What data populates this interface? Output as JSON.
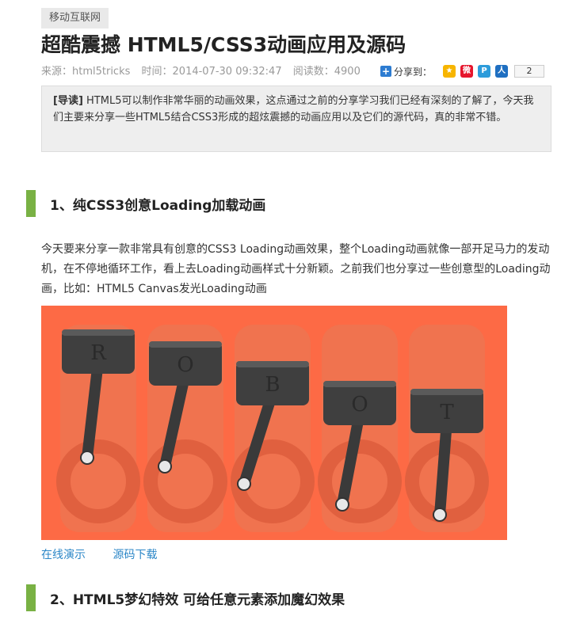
{
  "category": "移动互联网",
  "title": "超酷震撼 HTML5/CSS3动画应用及源码",
  "meta": {
    "source": "来源：html5tricks",
    "time": "时间：2014-07-30 09:32:47",
    "views": "阅读数：4900"
  },
  "share": {
    "label": "分享到：",
    "count": "2",
    "icons": [
      "qzone-icon",
      "weibo-icon",
      "pengyou-icon",
      "renren-icon"
    ],
    "colors": {
      "qzone": "#f7b500",
      "weibo": "#e6162d",
      "pengyou": "#2d9cdb",
      "renren": "#1f6fc1"
    }
  },
  "lead": {
    "prefix": "[导读]",
    "text": "HTML5可以制作非常华丽的动画效果，这点通过之前的分享学习我们已经有深刻的了解了，今天我们主要来分享一些HTML5结合CSS3形成的超炫震撼的动画应用以及它们的源代码，真的非常不错。"
  },
  "sections": [
    {
      "heading": "1、纯CSS3创意Loading加载动画"
    },
    {
      "heading": "2、HTML5梦幻特效 可给任意元素添加魔幻效果"
    }
  ],
  "paragraph": "今天要来分享一款非常具有创意的CSS3 Loading动画效果，整个Loading动画就像一部开足马力的发动机，在不停地循环工作，看上去Loading动画样式十分新颖。之前我们也分享过一些创意型的Loading动画，比如：HTML5 Canvas发光Loading动画",
  "demo": {
    "letters": [
      "R",
      "O",
      "B",
      "O",
      "T"
    ],
    "background": "#fd6a45"
  },
  "links": {
    "online_demo": "在线演示",
    "download": "源码下载"
  }
}
